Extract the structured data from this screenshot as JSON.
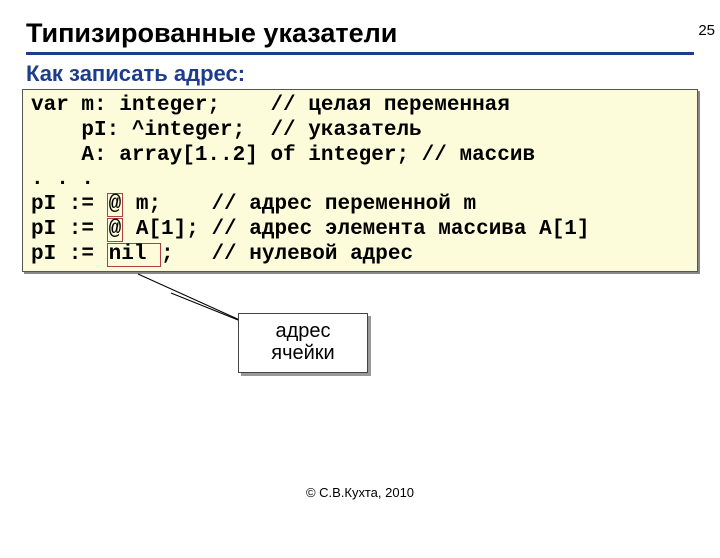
{
  "page_number": "25",
  "title": "Типизированные указатели",
  "subtitle": "Как записать адрес:",
  "code": {
    "l1a": "var m: integer;    // целая переменная",
    "l2a": "    pI: ^integer;  // указатель",
    "l3a": "    A: array[1..2] of integer; // массив",
    "l4a": ". . .",
    "l5a": "pI := ",
    "l5b": "@",
    "l5c": " m;    // адрес переменной m",
    "l6a": "pI := ",
    "l6b": "@",
    "l6c": " A[1]; // адрес элемента массива A[1]",
    "l7a": "pI := ",
    "l7b": "nil ",
    "l7c": ";   // нулевой адрес"
  },
  "callout": {
    "line1": "адрес",
    "line2": "ячейки"
  },
  "footer": "© С.В.Кухта, 2010"
}
